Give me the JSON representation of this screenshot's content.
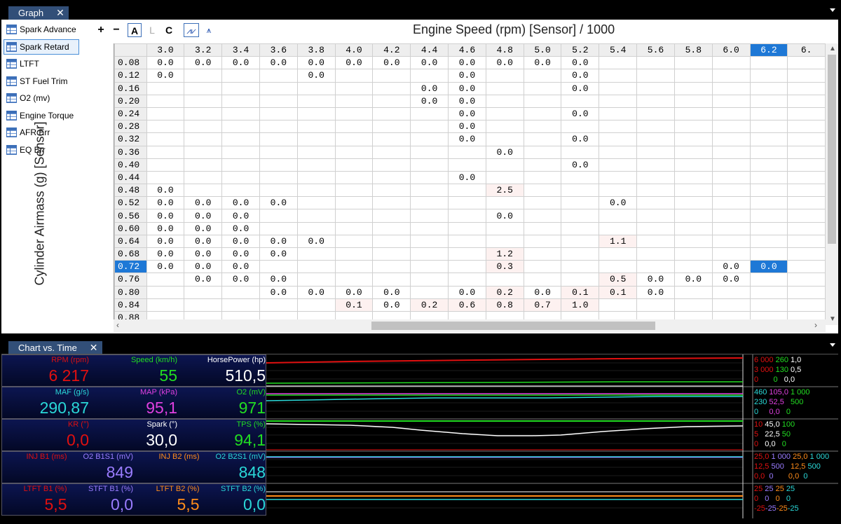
{
  "tabs": {
    "graph": "Graph",
    "chart": "Chart vs. Time",
    "close": "✕"
  },
  "list": [
    "Spark Advance",
    "Spark Retard",
    "LTFT",
    "ST Fuel Trim",
    "O2 (mv)",
    "Engine Torque",
    "AFR Err",
    "EQ Err"
  ],
  "selected_list_item": "Spark Retard",
  "toolbar": {
    "plus": "+",
    "minus": "−",
    "a": "A",
    "l": "L",
    "c": "C",
    "graph_icon": "graph-lines-icon",
    "graph_icon2": "graph-spikes-icon"
  },
  "axis": {
    "x_title": "Engine Speed (rpm) [Sensor] / 1000",
    "y_title": "Cylinder Airmass (g) [Sensor]"
  },
  "columns": [
    "3.0",
    "3.2",
    "3.4",
    "3.6",
    "3.8",
    "4.0",
    "4.2",
    "4.4",
    "4.6",
    "4.8",
    "5.0",
    "5.2",
    "5.4",
    "5.6",
    "5.8",
    "6.0",
    "6.2",
    "6."
  ],
  "highlight_col": "6.2",
  "highlight_row": "0.72",
  "rows": [
    {
      "r": "0.08",
      "c": [
        "0.0",
        "0.0",
        "0.0",
        "0.0",
        "0.0",
        "0.0",
        "0.0",
        "0.0",
        "0.0",
        "0.0",
        "0.0",
        "0.0",
        "",
        "",
        "",
        "",
        "",
        ""
      ]
    },
    {
      "r": "0.12",
      "c": [
        "0.0",
        "",
        "",
        "",
        "0.0",
        "",
        "",
        "",
        "0.0",
        "",
        "",
        "0.0",
        "",
        "",
        "",
        "",
        "",
        ""
      ]
    },
    {
      "r": "0.16",
      "c": [
        "",
        "",
        "",
        "",
        "",
        "",
        "",
        "0.0",
        "0.0",
        "",
        "",
        "0.0",
        "",
        "",
        "",
        "",
        "",
        ""
      ]
    },
    {
      "r": "0.20",
      "c": [
        "",
        "",
        "",
        "",
        "",
        "",
        "",
        "0.0",
        "0.0",
        "",
        "",
        "",
        "",
        "",
        "",
        "",
        "",
        ""
      ]
    },
    {
      "r": "0.24",
      "c": [
        "",
        "",
        "",
        "",
        "",
        "",
        "",
        "",
        "0.0",
        "",
        "",
        "0.0",
        "",
        "",
        "",
        "",
        "",
        ""
      ]
    },
    {
      "r": "0.28",
      "c": [
        "",
        "",
        "",
        "",
        "",
        "",
        "",
        "",
        "0.0",
        "",
        "",
        "",
        "",
        "",
        "",
        "",
        "",
        ""
      ]
    },
    {
      "r": "0.32",
      "c": [
        "",
        "",
        "",
        "",
        "",
        "",
        "",
        "",
        "0.0",
        "",
        "",
        "0.0",
        "",
        "",
        "",
        "",
        "",
        ""
      ]
    },
    {
      "r": "0.36",
      "c": [
        "",
        "",
        "",
        "",
        "",
        "",
        "",
        "",
        "",
        "0.0",
        "",
        "",
        "",
        "",
        "",
        "",
        "",
        ""
      ]
    },
    {
      "r": "0.40",
      "c": [
        "",
        "",
        "",
        "",
        "",
        "",
        "",
        "",
        "",
        "",
        "",
        "0.0",
        "",
        "",
        "",
        "",
        "",
        ""
      ]
    },
    {
      "r": "0.44",
      "c": [
        "",
        "",
        "",
        "",
        "",
        "",
        "",
        "",
        "0.0",
        "",
        "",
        "",
        "",
        "",
        "",
        "",
        "",
        ""
      ]
    },
    {
      "r": "0.48",
      "c": [
        "0.0",
        "",
        "",
        "",
        "",
        "",
        "",
        "",
        "",
        "2.5",
        "",
        "",
        "",
        "",
        "",
        "",
        "",
        ""
      ]
    },
    {
      "r": "0.52",
      "c": [
        "0.0",
        "0.0",
        "0.0",
        "0.0",
        "",
        "",
        "",
        "",
        "",
        "",
        "",
        "",
        "0.0",
        "",
        "",
        "",
        "",
        ""
      ]
    },
    {
      "r": "0.56",
      "c": [
        "0.0",
        "0.0",
        "0.0",
        "",
        "",
        "",
        "",
        "",
        "",
        "0.0",
        "",
        "",
        "",
        "",
        "",
        "",
        "",
        ""
      ]
    },
    {
      "r": "0.60",
      "c": [
        "0.0",
        "0.0",
        "0.0",
        "",
        "",
        "",
        "",
        "",
        "",
        "",
        "",
        "",
        "",
        "",
        "",
        "",
        "",
        ""
      ]
    },
    {
      "r": "0.64",
      "c": [
        "0.0",
        "0.0",
        "0.0",
        "0.0",
        "0.0",
        "",
        "",
        "",
        "",
        "",
        "",
        "",
        "1.1",
        "",
        "",
        "",
        "",
        ""
      ]
    },
    {
      "r": "0.68",
      "c": [
        "0.0",
        "0.0",
        "0.0",
        "0.0",
        "",
        "",
        "",
        "",
        "",
        "1.2",
        "",
        "",
        "",
        "",
        "",
        "",
        "",
        ""
      ]
    },
    {
      "r": "0.72",
      "c": [
        "0.0",
        "0.0",
        "0.0",
        "",
        "",
        "",
        "",
        "",
        "",
        "0.3",
        "",
        "",
        "",
        "",
        "",
        "0.0",
        "0.0",
        ""
      ]
    },
    {
      "r": "0.76",
      "c": [
        "",
        "0.0",
        "0.0",
        "0.0",
        "",
        "",
        "",
        "",
        "",
        "",
        "",
        "",
        "0.5",
        "0.0",
        "0.0",
        "0.0",
        "",
        ""
      ]
    },
    {
      "r": "0.80",
      "c": [
        "",
        "",
        "",
        "0.0",
        "0.0",
        "0.0",
        "0.0",
        "",
        "0.0",
        "0.2",
        "0.0",
        "0.1",
        "0.1",
        "0.0",
        "",
        "",
        "",
        ""
      ]
    },
    {
      "r": "0.84",
      "c": [
        "",
        "",
        "",
        "",
        "",
        "0.1",
        "0.0",
        "0.2",
        "0.6",
        "0.8",
        "0.7",
        "1.0",
        "",
        "",
        "",
        "",
        "",
        ""
      ]
    },
    {
      "r": "0.88",
      "c": [
        "",
        "",
        "",
        "",
        "",
        "",
        "",
        "",
        "",
        "",
        "",
        "",
        "",
        "",
        "",
        "",
        "",
        ""
      ]
    }
  ],
  "gauges": [
    [
      {
        "label": "RPM (rpm)",
        "value": "6 217",
        "color": "#e01010"
      },
      {
        "label": "Speed (km/h)",
        "value": "55",
        "color": "#22dd22"
      },
      {
        "label": "HorsePower (hp)",
        "value": "510,5",
        "color": "#ffffff"
      }
    ],
    [
      {
        "label": "MAF (g/s)",
        "value": "290,87",
        "color": "#2ad8d8"
      },
      {
        "label": "MAP (kPa)",
        "value": "95,1",
        "color": "#e040e0"
      },
      {
        "label": "O2 (mV)",
        "value": "971",
        "color": "#22dd22"
      }
    ],
    [
      {
        "label": "KR (°)",
        "value": "0,0",
        "color": "#e01010"
      },
      {
        "label": "Spark (°)",
        "value": "30,0",
        "color": "#ffffff"
      },
      {
        "label": "TPS (%)",
        "value": "94,1",
        "color": "#22dd22"
      }
    ],
    [
      {
        "label": "INJ B1 (ms)",
        "value": "",
        "color": "#e01010"
      },
      {
        "label": "O2 B1S1 (mV)",
        "value": "849",
        "color": "#9a7cff"
      },
      {
        "label": "INJ B2 (ms)",
        "value": "",
        "color": "#ff8c1a"
      },
      {
        "label": "O2 B2S1 (mV)",
        "value": "848",
        "color": "#2ad8d8"
      }
    ],
    [
      {
        "label": "LTFT B1 (%)",
        "value": "5,5",
        "color": "#e01010"
      },
      {
        "label": "STFT B1 (%)",
        "value": "0,0",
        "color": "#9a7cff"
      },
      {
        "label": "LTFT B2 (%)",
        "value": "5,5",
        "color": "#ff8c1a"
      },
      {
        "label": "STFT B2 (%)",
        "value": "0,0",
        "color": "#2ad8d8"
      }
    ]
  ],
  "scales": [
    [
      {
        "t": "6 000",
        "c": "#e01010"
      },
      {
        "t": " 260",
        "c": "#22dd22"
      },
      {
        "t": " 1,0",
        "c": "#ffffff"
      }
    ],
    [
      {
        "t": "3 000",
        "c": "#e01010"
      },
      {
        "t": " 130",
        "c": "#22dd22"
      },
      {
        "t": " 0,5",
        "c": "#ffffff"
      }
    ],
    [
      {
        "t": "0",
        "c": "#e01010"
      },
      {
        "t": "       0",
        "c": "#22dd22"
      },
      {
        "t": "   0,0",
        "c": "#ffffff"
      }
    ],
    [
      {
        "t": "460",
        "c": "#2ad8d8"
      },
      {
        "t": " 105,0",
        "c": "#e040e0"
      },
      {
        "t": " 1 000",
        "c": "#22dd22"
      }
    ],
    [
      {
        "t": "230",
        "c": "#2ad8d8"
      },
      {
        "t": " 52,5",
        "c": "#e040e0"
      },
      {
        "t": "   500",
        "c": "#22dd22"
      }
    ],
    [
      {
        "t": "0",
        "c": "#2ad8d8"
      },
      {
        "t": "     0,0",
        "c": "#e040e0"
      },
      {
        "t": "   0",
        "c": "#22dd22"
      }
    ],
    [
      {
        "t": "10",
        "c": "#e01010"
      },
      {
        "t": " 45,0",
        "c": "#ffffff"
      },
      {
        "t": " 100",
        "c": "#22dd22"
      }
    ],
    [
      {
        "t": "5",
        "c": "#e01010"
      },
      {
        "t": "   22,5",
        "c": "#ffffff"
      },
      {
        "t": " 50",
        "c": "#22dd22"
      }
    ],
    [
      {
        "t": "0",
        "c": "#e01010"
      },
      {
        "t": "   0,0",
        "c": "#ffffff"
      },
      {
        "t": "   0",
        "c": "#22dd22"
      }
    ],
    [
      {
        "t": "25,0",
        "c": "#e01010"
      },
      {
        "t": " 1 000",
        "c": "#9a7cff"
      },
      {
        "t": " 25,0",
        "c": "#ff8c1a"
      },
      {
        "t": " 1 000",
        "c": "#2ad8d8"
      }
    ],
    [
      {
        "t": "12,5",
        "c": "#e01010"
      },
      {
        "t": " 500",
        "c": "#9a7cff"
      },
      {
        "t": "   12,5",
        "c": "#ff8c1a"
      },
      {
        "t": " 500",
        "c": "#2ad8d8"
      }
    ],
    [
      {
        "t": "0,0",
        "c": "#e01010"
      },
      {
        "t": "  0",
        "c": "#9a7cff"
      },
      {
        "t": "       0,0",
        "c": "#ff8c1a"
      },
      {
        "t": "  0",
        "c": "#2ad8d8"
      }
    ],
    [
      {
        "t": "25",
        "c": "#e01010"
      },
      {
        "t": " 25",
        "c": "#9a7cff"
      },
      {
        "t": " 25",
        "c": "#ff8c1a"
      },
      {
        "t": " 25",
        "c": "#2ad8d8"
      }
    ],
    [
      {
        "t": "0",
        "c": "#e01010"
      },
      {
        "t": "   0",
        "c": "#9a7cff"
      },
      {
        "t": "   0",
        "c": "#ff8c1a"
      },
      {
        "t": "   0",
        "c": "#2ad8d8"
      }
    ],
    [
      {
        "t": "-25",
        "c": "#e01010"
      },
      {
        "t": "-25",
        "c": "#9a7cff"
      },
      {
        "t": "-25",
        "c": "#ff8c1a"
      },
      {
        "t": "-25",
        "c": "#2ad8d8"
      }
    ]
  ]
}
